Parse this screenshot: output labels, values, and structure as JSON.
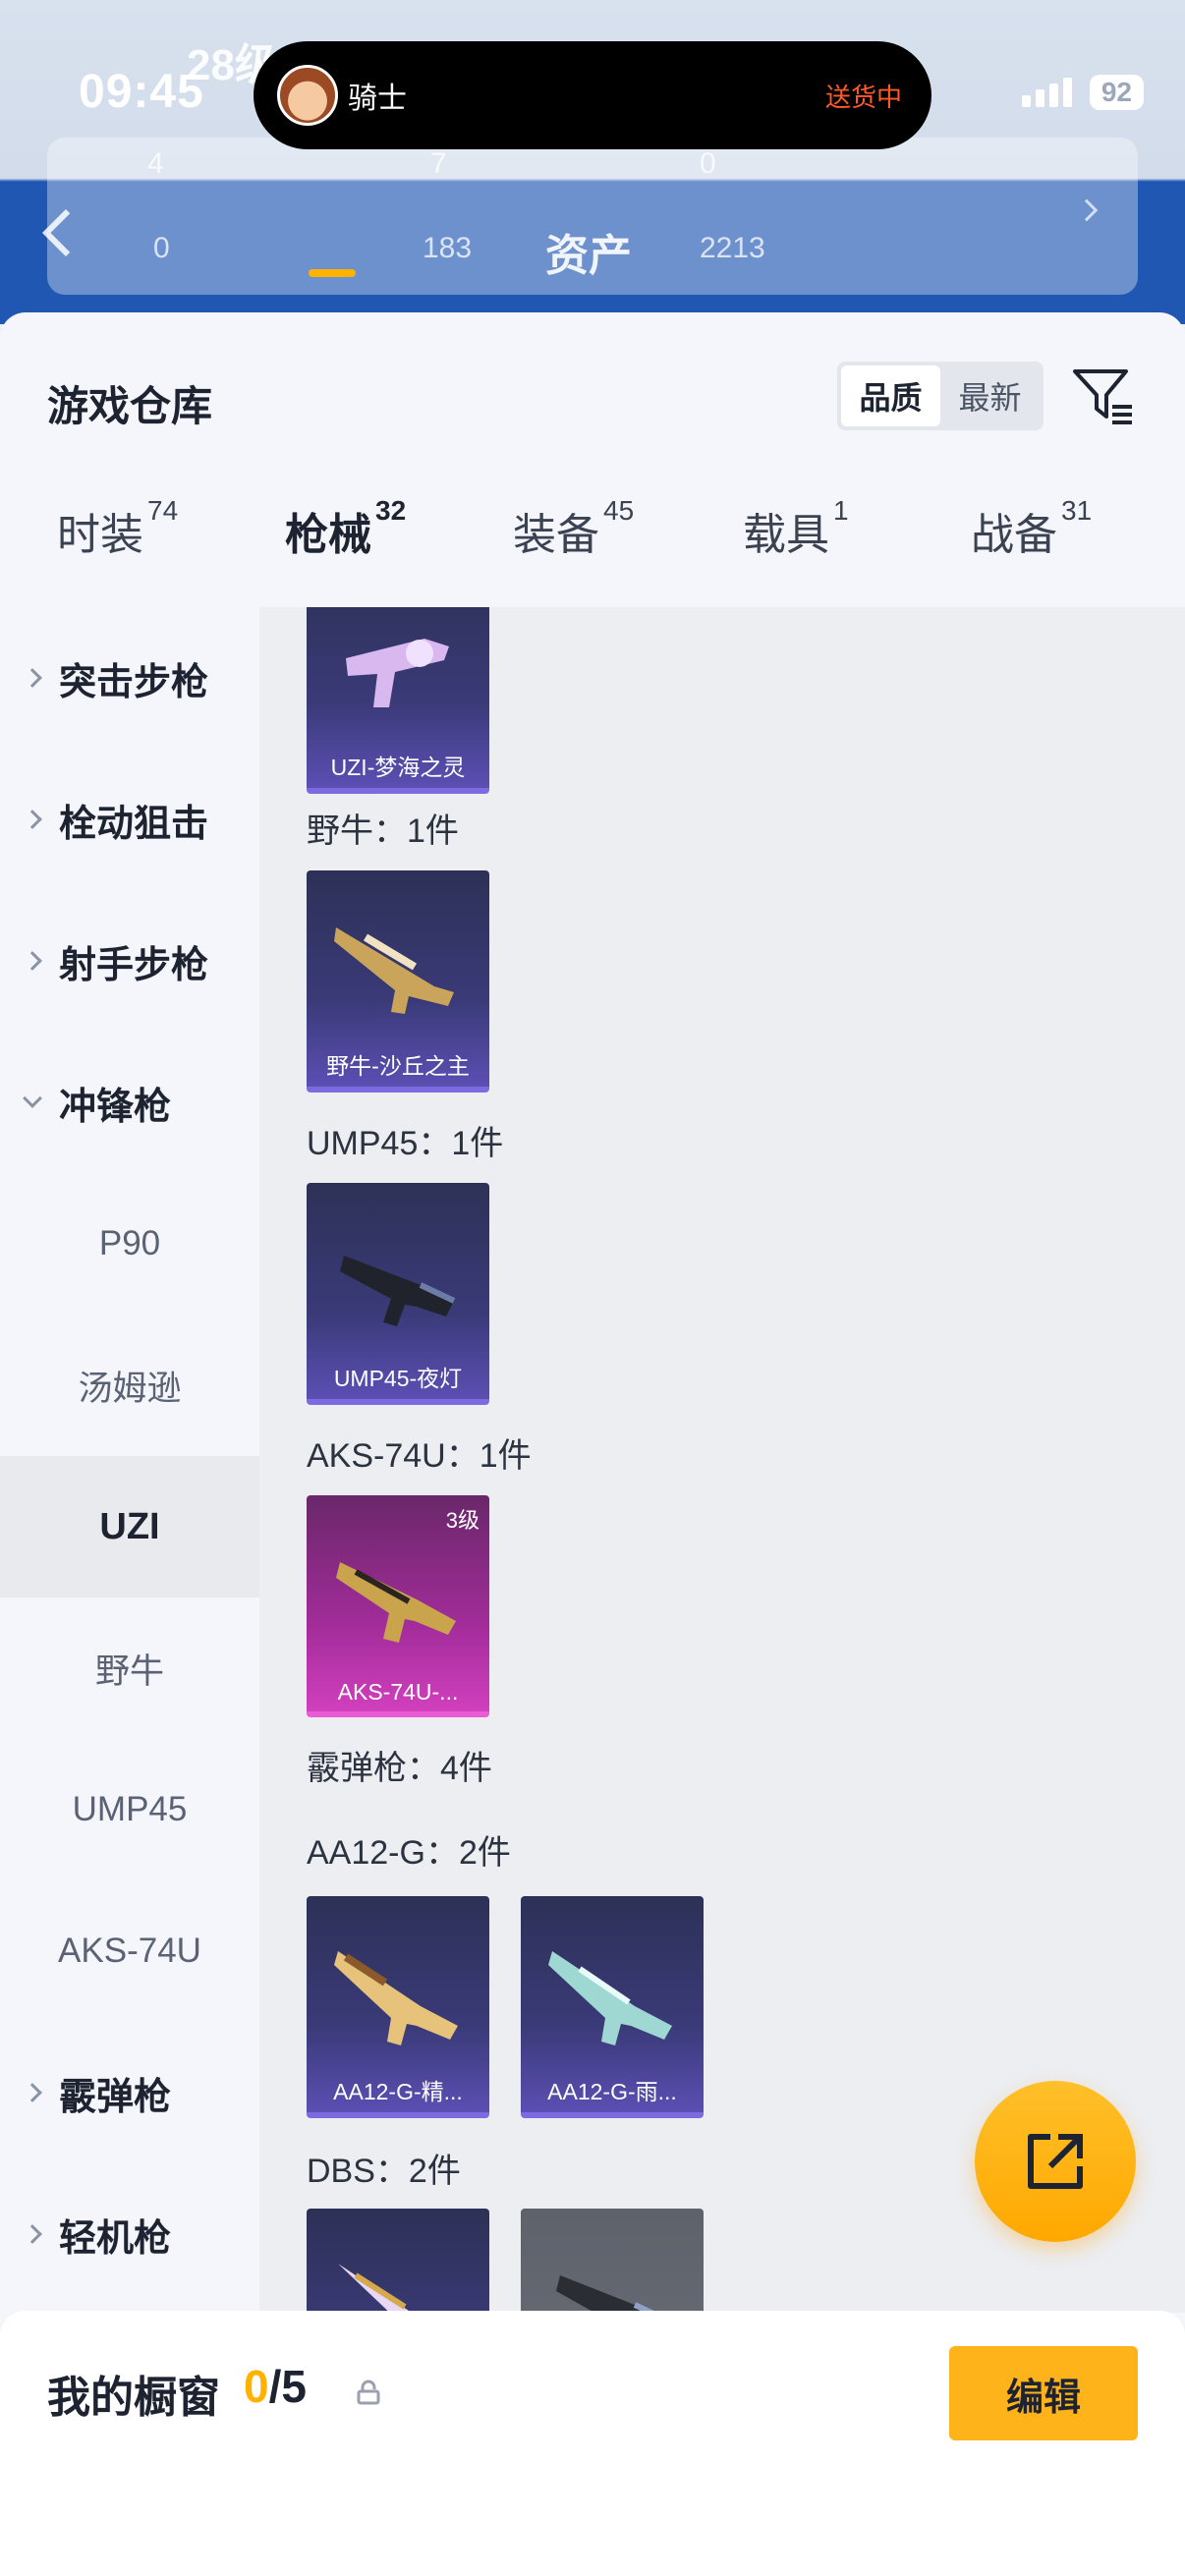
{
  "status_bar": {
    "time": "09:45",
    "battery": "92"
  },
  "island": {
    "name": "骑士",
    "status": "送货中"
  },
  "header_bg": {
    "page_title": "资产",
    "level_text": "28级",
    "stats": [
      "4",
      "7",
      "0",
      "0",
      "183",
      "2213"
    ]
  },
  "sheet": {
    "title": "游戏仓库",
    "sort_options": [
      "品质",
      "最新"
    ],
    "active_sort": "品质"
  },
  "tabs": [
    {
      "label": "时装",
      "count": "74"
    },
    {
      "label": "枪械",
      "count": "32"
    },
    {
      "label": "装备",
      "count": "45"
    },
    {
      "label": "载具",
      "count": "1"
    },
    {
      "label": "战备",
      "count": "31"
    }
  ],
  "active_tab": "枪械",
  "sidebar": {
    "categories": [
      "突击步枪",
      "栓动狙击",
      "射手步枪",
      "冲锋枪",
      "霰弹枪",
      "轻机枪"
    ],
    "subitems": [
      "P90",
      "汤姆逊",
      "UZI",
      "野牛",
      "UMP45",
      "AKS-74U"
    ],
    "selected": "UZI"
  },
  "inventory": {
    "groups": [
      {
        "label": "野牛：1件"
      },
      {
        "label": "UMP45：1件"
      },
      {
        "label": "AKS-74U：1件"
      },
      {
        "label": "霰弹枪：4件"
      },
      {
        "label": "AA12-G：2件"
      },
      {
        "label": "DBS：2件"
      }
    ],
    "items": [
      {
        "name": "UZI-梦海之灵",
        "rarity": "purple"
      },
      {
        "name": "野牛-沙丘之主",
        "rarity": "purple"
      },
      {
        "name": "UMP45-夜灯",
        "rarity": "purple"
      },
      {
        "name": "AKS-74U-...",
        "rarity": "pink",
        "level": "3级"
      },
      {
        "name": "AA12-G-精...",
        "rarity": "purple"
      },
      {
        "name": "AA12-G-雨...",
        "rarity": "purple"
      },
      {
        "name": "",
        "rarity": "purple"
      },
      {
        "name": "",
        "rarity": "grey"
      }
    ]
  },
  "showcase": {
    "label": "我的橱窗",
    "current": "0",
    "total": "/5",
    "edit_label": "编辑"
  },
  "colors": {
    "accent": "#ffb300",
    "purple_card": "#3a3a78",
    "pink_card": "#a22c9a",
    "header_blue": "#1f57b3"
  },
  "icons": [
    "back-chevron-icon",
    "filter-icon",
    "share-icon",
    "lock-icon",
    "chevron-right-icon",
    "chevron-down-icon"
  ]
}
